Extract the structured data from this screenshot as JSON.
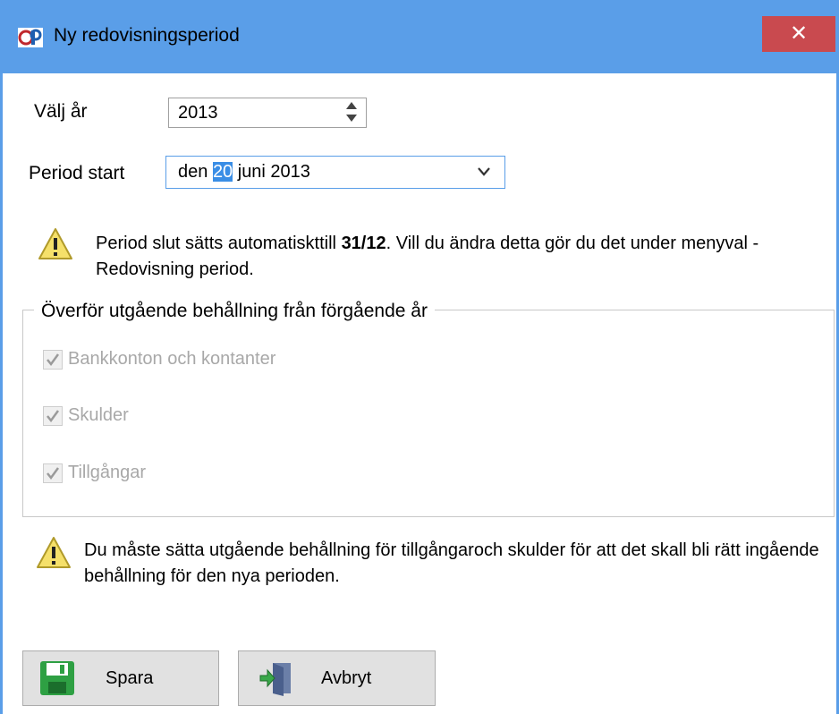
{
  "window": {
    "title": "Ny redovisningsperiod",
    "close_glyph": "✕",
    "app_icon": "app-logo-icon"
  },
  "form": {
    "year_label": "Välj år",
    "year_value": "2013",
    "period_start_label": "Period start",
    "period_start_prefix": "den ",
    "period_start_day": "20",
    "period_start_suffix": " juni 2013"
  },
  "notice1": {
    "text_before": "Period slut sätts automatiskttill ",
    "bold_date": "31/12",
    "text_after": ". Vill du ändra detta gör du det under menyval - Redovisning period."
  },
  "transfer": {
    "title": "Överför utgående behållning från förgående år",
    "options": [
      {
        "label": "Bankkonton och kontanter",
        "checked": true,
        "enabled": false
      },
      {
        "label": "Skulder",
        "checked": true,
        "enabled": false
      },
      {
        "label": "Tillgångar",
        "checked": true,
        "enabled": false
      }
    ]
  },
  "notice2": {
    "text": "Du måste sätta utgående behållning för tillgångaroch skulder för att det skall bli rätt ingående behållning för den nya perioden."
  },
  "buttons": {
    "save": "Spara",
    "cancel": "Avbryt"
  },
  "colors": {
    "titlebar": "#5a9ee8",
    "close": "#c94a4f",
    "selection": "#3a8ee6",
    "warning": "#f5e06a"
  }
}
